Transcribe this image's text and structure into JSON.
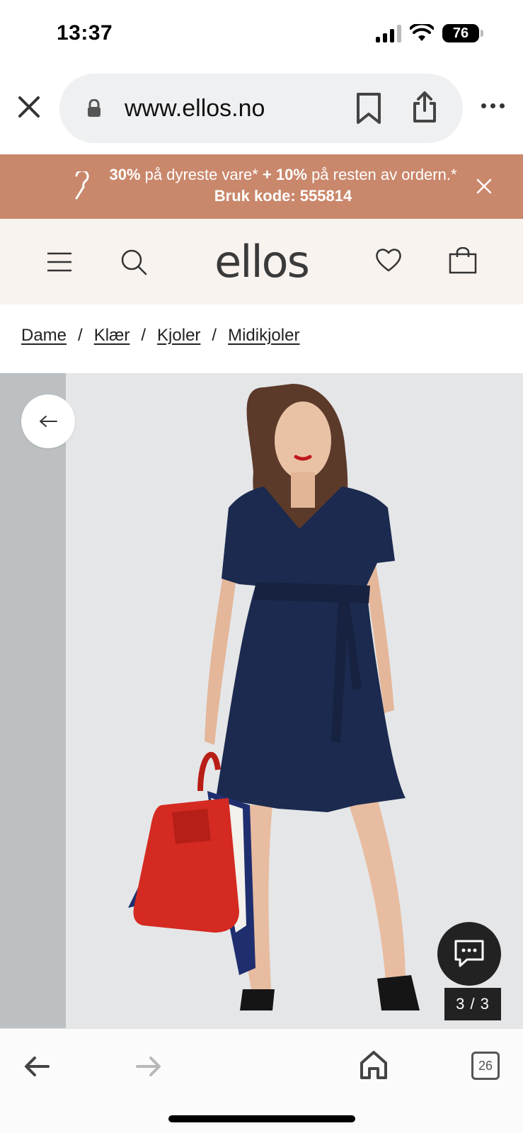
{
  "status": {
    "time": "13:37",
    "battery": "76"
  },
  "browser": {
    "url": "www.ellos.no"
  },
  "promo": {
    "part1_bold": "30%",
    "part2": " på dyreste vare* ",
    "part3_bold": "+ 10%",
    "part4": " på resten av ordern.* ",
    "part5_bold": "Bruk kode: 555814"
  },
  "header": {
    "logo": "ellos"
  },
  "breadcrumb": [
    "Dame",
    "Klær",
    "Kjoler",
    "Midikjoler"
  ],
  "gallery": {
    "counter": "3 / 3"
  },
  "toolbar": {
    "tab_count": "26"
  },
  "colors": {
    "promo_bg": "#c9876b",
    "header_bg": "#f8f3ef",
    "dress": "#1b2a4e",
    "bag": "#d42a21"
  }
}
